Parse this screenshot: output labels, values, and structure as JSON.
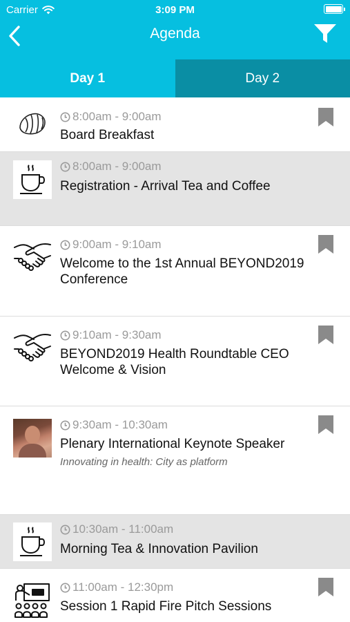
{
  "status_bar": {
    "carrier": "Carrier",
    "time": "3:09 PM"
  },
  "nav": {
    "title": "Agenda"
  },
  "tabs": [
    {
      "label": "Day 1",
      "active": true
    },
    {
      "label": "Day 2",
      "active": false
    }
  ],
  "colors": {
    "accent": "#06bfe0",
    "tab_inactive": "#0a8ea4",
    "grey_row": "#e4e4e4",
    "bookmark": "#8a8a8a"
  },
  "sessions": [
    {
      "time": "8:00am - 9:00am",
      "title": "Board Breakfast",
      "icon": "croissant-icon",
      "bookmarkable": true
    },
    {
      "time": "8:00am - 9:00am",
      "title": "Registration - Arrival Tea and Coffee",
      "icon": "coffee-cup-icon",
      "bookmarkable": false
    },
    {
      "time": "9:00am - 9:10am",
      "title": "Welcome to the 1st Annual BEYOND2019 Conference",
      "icon": "handshake-icon",
      "bookmarkable": true
    },
    {
      "time": "9:10am - 9:30am",
      "title": "BEYOND2019 Health Roundtable CEO Welcome & Vision",
      "icon": "handshake-icon",
      "bookmarkable": true
    },
    {
      "time": "9:30am - 10:30am",
      "title": "Plenary International Keynote Speaker",
      "subtitle": "Innovating in health: City as platform",
      "icon": "speaker-photo",
      "bookmarkable": true
    },
    {
      "time": "10:30am - 11:00am",
      "title": "Morning Tea & Innovation Pavilion",
      "icon": "coffee-cup-icon",
      "bookmarkable": false
    },
    {
      "time": "11:00am - 12:30pm",
      "title": "Session 1 Rapid Fire Pitch Sessions",
      "icon": "presentation-icon",
      "bookmarkable": true
    }
  ]
}
